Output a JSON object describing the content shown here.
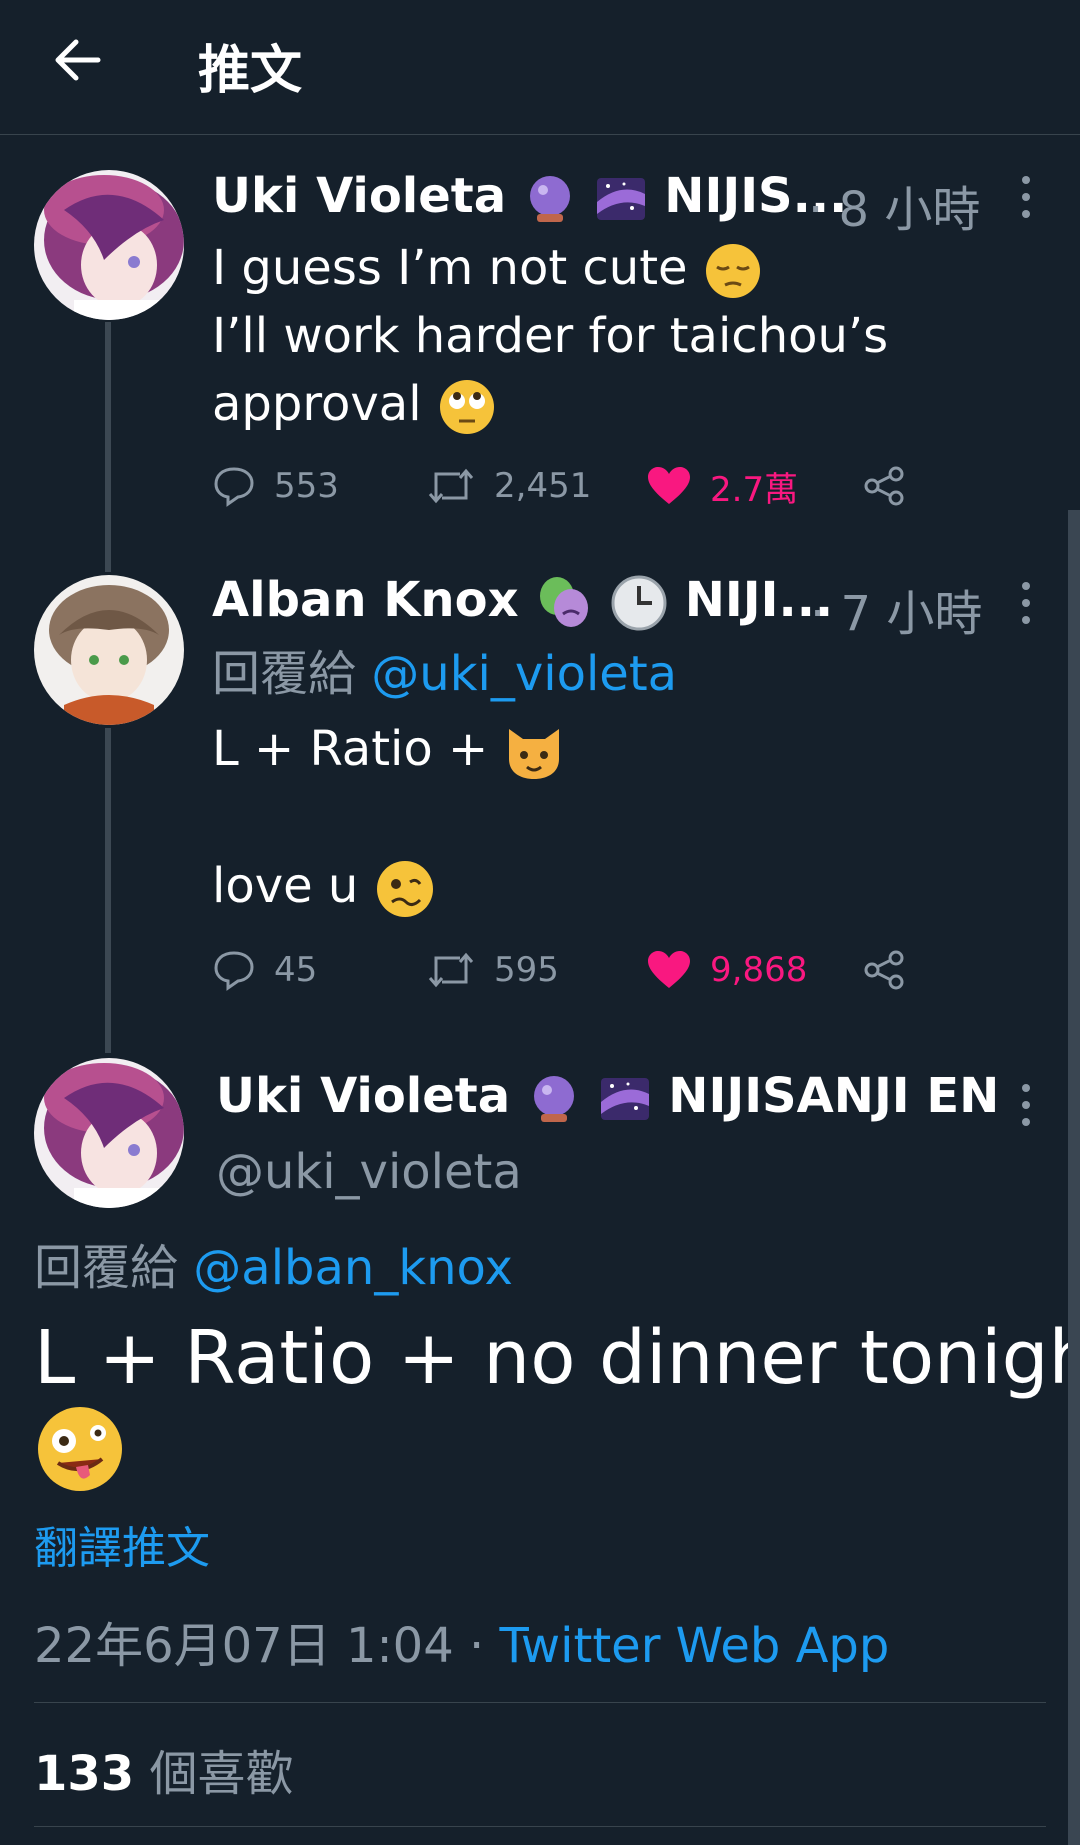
{
  "header": {
    "title": "推文"
  },
  "thread": [
    {
      "display_name": "Uki Violeta",
      "name_suffix": "NIJIS...",
      "time": "· 8 小時",
      "lines": [
        "I guess I’m not cute",
        "I’ll work harder for taichou’s",
        "approval"
      ],
      "replies": "553",
      "retweets": "2,451",
      "likes": "2.7萬"
    },
    {
      "display_name": "Alban Knox",
      "name_suffix": "NIJI...",
      "time": "· 7 小時",
      "reply_prefix": "回覆給",
      "reply_handle": "@uki_violeta",
      "line1": "L + Ratio +",
      "line2": "love u",
      "replies": "45",
      "retweets": "595",
      "likes": "9,868"
    }
  ],
  "main_tweet": {
    "display_name": "Uki Violeta",
    "name_suffix": "NIJISANJI EN",
    "handle": "@uki_violeta",
    "reply_prefix": "回覆給",
    "reply_handle": "@alban_knox",
    "text": "L + Ratio + no dinner tonight",
    "translate": "翻譯推文",
    "date": "22年6月07日 1:04",
    "separator": "·",
    "source": "Twitter Web App",
    "likes_count": "133",
    "likes_label": "個喜歡"
  },
  "colors": {
    "background": "#15202b",
    "link": "#1d9bf0",
    "like": "#f91880",
    "muted": "#8b98a5"
  }
}
